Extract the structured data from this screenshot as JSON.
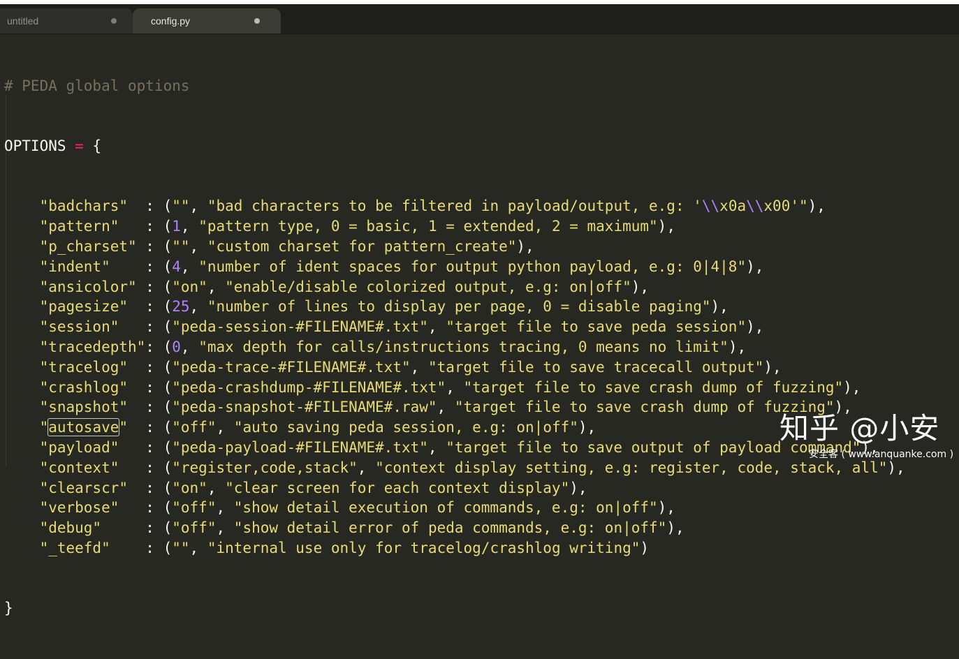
{
  "tabs": [
    {
      "label": "untitled",
      "active": false
    },
    {
      "label": "config.py",
      "active": true
    }
  ],
  "code": {
    "comment": "# PEDA global options",
    "decl_name": "OPTIONS",
    "decl_eq": "=",
    "decl_brace": "{",
    "closing_brace": "}",
    "options": [
      {
        "key": "\"badchars\"",
        "pad": "  ",
        "value_prefix": "(\"\", ",
        "value_text": "\"bad characters to be filtered in payload/output, e.g: '\\\\x0a\\\\x00'\"",
        "suffix": "),"
      },
      {
        "key": "\"pattern\"",
        "pad": "   ",
        "value_prefix": "(1, ",
        "value_text": "\"pattern type, 0 = basic, 1 = extended, 2 = maximum\"",
        "suffix": "),"
      },
      {
        "key": "\"p_charset\"",
        "pad": " ",
        "value_prefix": "(\"\", ",
        "value_text": "\"custom charset for pattern_create\"",
        "suffix": "),"
      },
      {
        "key": "\"indent\"",
        "pad": "    ",
        "value_prefix": "(4, ",
        "value_text": "\"number of ident spaces for output python payload, e.g: 0|4|8\"",
        "suffix": "),"
      },
      {
        "key": "\"ansicolor\"",
        "pad": " ",
        "value_prefix": "(\"on\", ",
        "value_text": "\"enable/disable colorized output, e.g: on|off\"",
        "suffix": "),"
      },
      {
        "key": "\"pagesize\"",
        "pad": "  ",
        "value_prefix": "(25, ",
        "value_text": "\"number of lines to display per page, 0 = disable paging\"",
        "suffix": "),"
      },
      {
        "key": "\"session\"",
        "pad": "   ",
        "value_prefix": "(\"peda-session-#FILENAME#.txt\", ",
        "value_text": "\"target file to save peda session\"",
        "suffix": "),"
      },
      {
        "key": "\"tracedepth\"",
        "pad": "",
        "value_prefix": "(0, ",
        "value_text": "\"max depth for calls/instructions tracing, 0 means no limit\"",
        "suffix": "),"
      },
      {
        "key": "\"tracelog\"",
        "pad": "  ",
        "value_prefix": "(\"peda-trace-#FILENAME#.txt\", ",
        "value_text": "\"target file to save tracecall output\"",
        "suffix": "),"
      },
      {
        "key": "\"crashlog\"",
        "pad": "  ",
        "value_prefix": "(\"peda-crashdump-#FILENAME#.txt\", ",
        "value_text": "\"target file to save crash dump of fuzzing\"",
        "suffix": "),"
      },
      {
        "key": "\"snapshot\"",
        "pad": "  ",
        "value_prefix": "(\"peda-snapshot-#FILENAME#.raw\", ",
        "value_text": "\"target file to save crash dump of fuzzing\"",
        "suffix": "),"
      },
      {
        "key": "\"autosave\"",
        "pad": "  ",
        "value_prefix": "(\"off\", ",
        "value_text": "\"auto saving peda session, e.g: on|off\"",
        "suffix": "),"
      },
      {
        "key": "\"payload\"",
        "pad": "   ",
        "value_prefix": "(\"peda-payload-#FILENAME#.txt\", ",
        "value_text": "\"target file to save output of payload command\"",
        "suffix": "),"
      },
      {
        "key": "\"context\"",
        "pad": "   ",
        "value_prefix": "(\"register,code,stack\", ",
        "value_text": "\"context display setting, e.g: register, code, stack, all\"",
        "suffix": "),"
      },
      {
        "key": "\"clearscr\"",
        "pad": "  ",
        "value_prefix": "(\"on\", ",
        "value_text": "\"clear screen for each context display\"",
        "suffix": "),"
      },
      {
        "key": "\"verbose\"",
        "pad": "   ",
        "value_prefix": "(\"off\", ",
        "value_text": "\"show detail execution of commands, e.g: on|off\"",
        "suffix": "),"
      },
      {
        "key": "\"debug\"",
        "pad": "     ",
        "value_prefix": "(\"off\", ",
        "value_text": "\"show detail error of peda commands, e.g: on|off\"",
        "suffix": "),"
      },
      {
        "key": "\"_teefd\"",
        "pad": "    ",
        "value_prefix": "(\"\", ",
        "value_text": "\"internal use only for tracelog/crashlog writing\"",
        "suffix": ")"
      }
    ]
  },
  "watermark": {
    "main": "知乎 @小安",
    "sub": "安全客 ( www.anquanke.com )"
  },
  "colors": {
    "background": "#272822",
    "string": "#e6db74",
    "number": "#ae81ff",
    "operator": "#f92672",
    "comment": "#75715e",
    "text": "#f8f8f2"
  }
}
